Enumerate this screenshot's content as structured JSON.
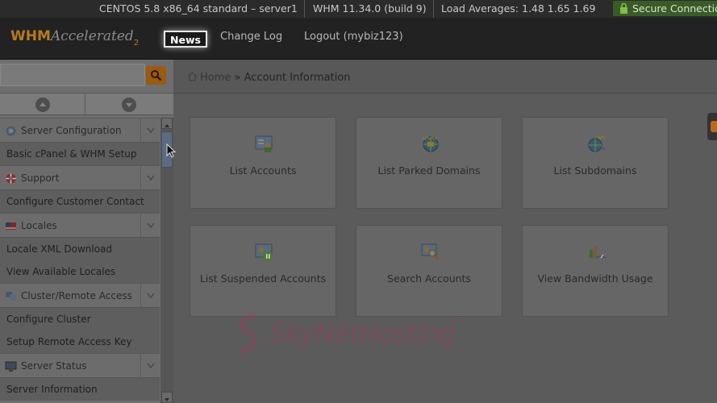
{
  "status_bar": {
    "os": "CENTOS 5.8 x86_64 standard – server1",
    "version": "WHM 11.34.0 (build 9)",
    "load": "Load Averages: 1.48 1.65 1.69",
    "secure": "Secure Connection"
  },
  "header": {
    "logo_whm": "WHM",
    "logo_accelerated": "Accelerated",
    "logo_version": "2",
    "nav": [
      "News",
      "Change Log",
      "Logout (mybiz123)"
    ]
  },
  "sidebar": {
    "search_placeholder": "",
    "sections": [
      {
        "title": "Server Configuration",
        "icon": "gear-icon",
        "items": [
          "Basic cPanel & WHM Setup"
        ]
      },
      {
        "title": "Support",
        "icon": "lifebuoy-icon",
        "items": [
          "Configure Customer Contact"
        ]
      },
      {
        "title": "Locales",
        "icon": "flag-icon",
        "items": [
          "Locale XML Download",
          "View Available Locales"
        ]
      },
      {
        "title": "Cluster/Remote Access",
        "icon": "cluster-icon",
        "items": [
          "Configure Cluster",
          "Setup Remote Access Key"
        ]
      },
      {
        "title": "Server Status",
        "icon": "monitor-icon",
        "items": [
          "Server Information"
        ]
      }
    ]
  },
  "breadcrumb": {
    "home": "Home",
    "separator": "»",
    "current": "Account Information"
  },
  "tiles": [
    {
      "label": "List Accounts",
      "icon": "list-accounts-icon"
    },
    {
      "label": "List Parked Domains",
      "icon": "parked-domains-icon"
    },
    {
      "label": "List Subdomains",
      "icon": "subdomains-icon"
    },
    {
      "label": "List Suspended Accounts",
      "icon": "suspended-accounts-icon"
    },
    {
      "label": "Search Accounts",
      "icon": "search-accounts-icon"
    },
    {
      "label": "View Bandwidth Usage",
      "icon": "bandwidth-icon"
    }
  ],
  "watermark": {
    "text": "SkyNetHosting",
    "sub": ".net"
  }
}
